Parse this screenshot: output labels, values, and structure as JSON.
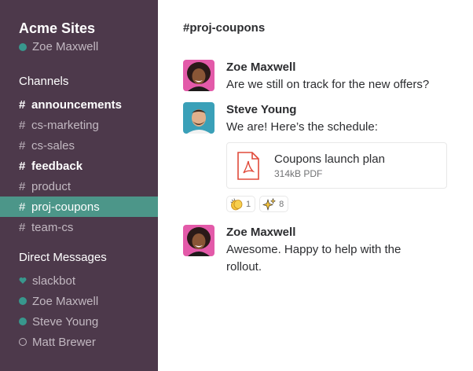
{
  "sidebar": {
    "workspace": "Acme Sites",
    "current_user": "Zoe Maxwell",
    "channels_header": "Channels",
    "channels": [
      {
        "hash": "#",
        "name": "announcements",
        "bold": true
      },
      {
        "hash": "#",
        "name": "cs-marketing",
        "bold": false
      },
      {
        "hash": "#",
        "name": "cs-sales",
        "bold": false
      },
      {
        "hash": "#",
        "name": "feedback",
        "bold": true
      },
      {
        "hash": "#",
        "name": "product",
        "bold": false
      },
      {
        "hash": "#",
        "name": "proj-coupons",
        "bold": false,
        "active": true
      },
      {
        "hash": "#",
        "name": "team-cs",
        "bold": false
      }
    ],
    "dm_header": "Direct Messages",
    "dms": [
      {
        "name": "slackbot",
        "status": "heart"
      },
      {
        "name": "Zoe Maxwell",
        "status": "online"
      },
      {
        "name": "Steve Young",
        "status": "online"
      },
      {
        "name": "Matt Brewer",
        "status": "away"
      }
    ]
  },
  "main": {
    "channel_title": "#proj-coupons",
    "messages": [
      {
        "sender": "Zoe Maxwell",
        "text": "Are we still on track for the new offers?"
      },
      {
        "sender": "Steve Young",
        "text": "We are! Here’s the schedule:",
        "attachment": {
          "title": "Coupons launch plan",
          "meta": "314kB PDF"
        },
        "reactions": [
          {
            "icon": "clapping-hands-icon",
            "count": "1"
          },
          {
            "icon": "sparkles-icon",
            "count": "8"
          }
        ]
      },
      {
        "sender": "Zoe Maxwell",
        "text": "Awesome. Happy to help with the rollout."
      }
    ]
  },
  "colors": {
    "sidebar_bg": "#4d394b",
    "active_channel": "#4c9689",
    "presence_online": "#38978d",
    "pdf_red": "#e04a3a"
  }
}
